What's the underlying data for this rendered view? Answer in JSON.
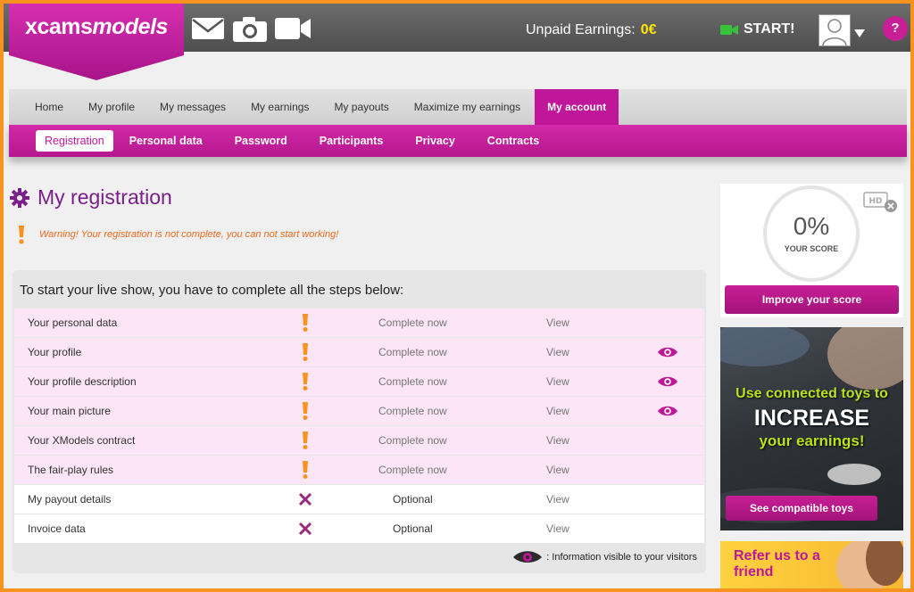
{
  "header": {
    "logo_a": "xcams",
    "logo_b": "models",
    "earnings_label": "Unpaid Earnings:",
    "earnings_value": "0€",
    "start_label": "START!",
    "help_label": "?"
  },
  "nav": {
    "tabs": [
      {
        "label": "Home"
      },
      {
        "label": "My profile"
      },
      {
        "label": "My messages"
      },
      {
        "label": "My earnings"
      },
      {
        "label": "My payouts"
      },
      {
        "label": "Maximize my earnings"
      },
      {
        "label": "My account",
        "active": true
      }
    ],
    "subtabs": [
      {
        "label": "Registration",
        "active": true
      },
      {
        "label": "Personal data"
      },
      {
        "label": "Password"
      },
      {
        "label": "Participants"
      },
      {
        "label": "Privacy"
      },
      {
        "label": "Contracts"
      }
    ]
  },
  "main": {
    "title": "My registration",
    "warning": "Warning! Your registration is not complete, you can not start working!",
    "panel_heading": "To start your live show, you have to complete all the steps below:",
    "steps": [
      {
        "name": "Your personal data",
        "status": "pending",
        "action": "Complete now",
        "view": "View",
        "visible": false
      },
      {
        "name": "Your profile",
        "status": "pending",
        "action": "Complete now",
        "view": "View",
        "visible": true
      },
      {
        "name": "Your profile description",
        "status": "pending",
        "action": "Complete now",
        "view": "View",
        "visible": true
      },
      {
        "name": "Your main picture",
        "status": "pending",
        "action": "Complete now",
        "view": "View",
        "visible": true
      },
      {
        "name": "Your XModels contract",
        "status": "pending",
        "action": "Complete now",
        "view": "View",
        "visible": false
      },
      {
        "name": "The fair-play rules",
        "status": "pending",
        "action": "Complete now",
        "view": "View",
        "visible": false
      },
      {
        "name": "My payout details",
        "status": "optional",
        "action": "Optional",
        "view": "View",
        "visible": false
      },
      {
        "name": "Invoice data",
        "status": "optional",
        "action": "Optional",
        "view": "View",
        "visible": false
      }
    ],
    "legend": ": Information visible to your visitors"
  },
  "sidebar": {
    "score_value": "0%",
    "score_label": "YOUR SCORE",
    "hd_label": "HD",
    "improve_button": "Improve your score",
    "promo_line1": "Use connected toys to",
    "promo_line2": "INCREASE",
    "promo_line3": "your earnings!",
    "promo_button": "See compatible toys",
    "refer_text": "Refer us to a friend"
  },
  "colors": {
    "brand_pink": "#c0169a",
    "warning_orange": "#f06a1b",
    "accent_yellow": "#ffe600",
    "promo_green": "#b9e21b"
  }
}
